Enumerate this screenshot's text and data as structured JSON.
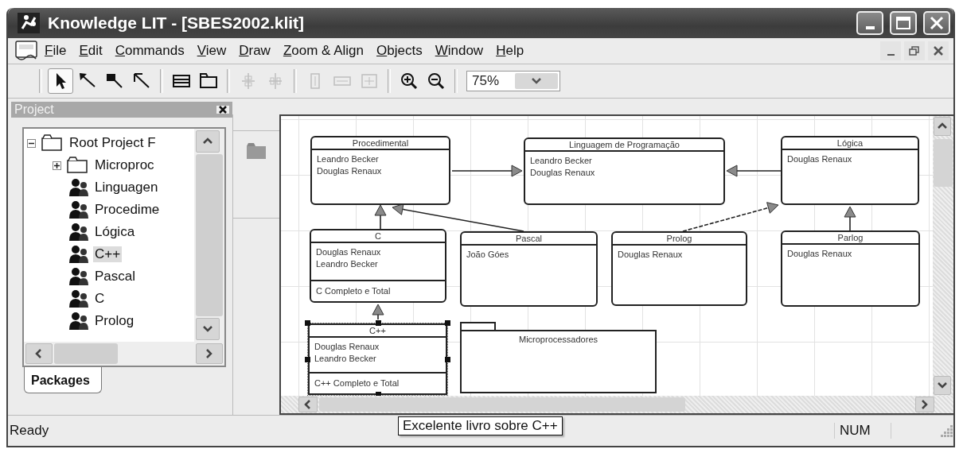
{
  "window": {
    "title": "Knowledge LIT - [SBES2002.klit]"
  },
  "menu": {
    "items": [
      "File",
      "Edit",
      "Commands",
      "View",
      "Draw",
      "Zoom & Align",
      "Objects",
      "Window",
      "Help"
    ]
  },
  "toolbar": {
    "tools": [
      {
        "kind": "pointer",
        "pressed": true,
        "disabled": false
      },
      {
        "kind": "line-arrow",
        "pressed": false,
        "disabled": false
      },
      {
        "kind": "box-arrow",
        "pressed": false,
        "disabled": false
      },
      {
        "kind": "open-arrow",
        "pressed": false,
        "disabled": false
      },
      {
        "kind": "class-box",
        "pressed": false,
        "disabled": false
      },
      {
        "kind": "package",
        "pressed": false,
        "disabled": false
      },
      {
        "kind": "align-vertical",
        "pressed": false,
        "disabled": true
      },
      {
        "kind": "align-horizontal",
        "pressed": false,
        "disabled": true
      },
      {
        "kind": "same-height",
        "pressed": false,
        "disabled": true
      },
      {
        "kind": "same-width",
        "pressed": false,
        "disabled": true
      },
      {
        "kind": "same-size",
        "pressed": false,
        "disabled": true
      },
      {
        "kind": "zoom-in",
        "pressed": false,
        "disabled": false
      },
      {
        "kind": "zoom-out",
        "pressed": false,
        "disabled": false
      }
    ],
    "zoom": "75%"
  },
  "project": {
    "title": "Project",
    "tab": "Packages",
    "tree": [
      {
        "kind": "folder",
        "label": "Root Project F",
        "expanded": true,
        "selected": false,
        "children": [
          {
            "kind": "folder",
            "label": "Microproc",
            "expanded": false,
            "selected": false
          },
          {
            "kind": "class",
            "label": "Linguagen",
            "selected": false
          },
          {
            "kind": "class",
            "label": "Procedime",
            "selected": false
          },
          {
            "kind": "class",
            "label": "Lógica",
            "selected": false
          },
          {
            "kind": "class",
            "label": "C++",
            "selected": true
          },
          {
            "kind": "class",
            "label": "Pascal",
            "selected": false
          },
          {
            "kind": "class",
            "label": "C",
            "selected": false
          },
          {
            "kind": "class",
            "label": "Prolog",
            "selected": false
          }
        ]
      }
    ]
  },
  "diagram": {
    "nodes": [
      {
        "kind": "class",
        "name": "Procedimental",
        "attributes": [
          "Leandro Becker",
          "Douglas Renaux"
        ],
        "selected": false
      },
      {
        "kind": "class",
        "name": "Linguagem de Programação",
        "attributes": [
          "Leandro Becker",
          "Douglas Renaux"
        ],
        "selected": false
      },
      {
        "kind": "class",
        "name": "Lógica",
        "attributes": [
          "Douglas Renaux"
        ],
        "selected": false
      },
      {
        "kind": "class",
        "name": "C",
        "attributes": [
          "Douglas Renaux",
          "Leandro Becker"
        ],
        "notes": [
          "C Completo e Total"
        ],
        "selected": false
      },
      {
        "kind": "class",
        "name": "Pascal",
        "attributes": [
          "João Góes"
        ],
        "selected": false
      },
      {
        "kind": "class",
        "name": "Prolog",
        "attributes": [
          "Douglas Renaux"
        ],
        "selected": false
      },
      {
        "kind": "class",
        "name": "Parlog",
        "attributes": [
          "Douglas Renaux"
        ],
        "selected": false
      },
      {
        "kind": "class",
        "name": "C++",
        "attributes": [
          "Douglas Renaux",
          "Leandro Becker"
        ],
        "notes": [
          "C++ Completo e Total"
        ],
        "selected": true
      },
      {
        "kind": "package",
        "name": "Microprocessadores",
        "selected": false
      }
    ]
  },
  "tooltip": "Excelente livro sobre C++",
  "status_bar": {
    "message": "Ready",
    "indicator": "NUM"
  }
}
